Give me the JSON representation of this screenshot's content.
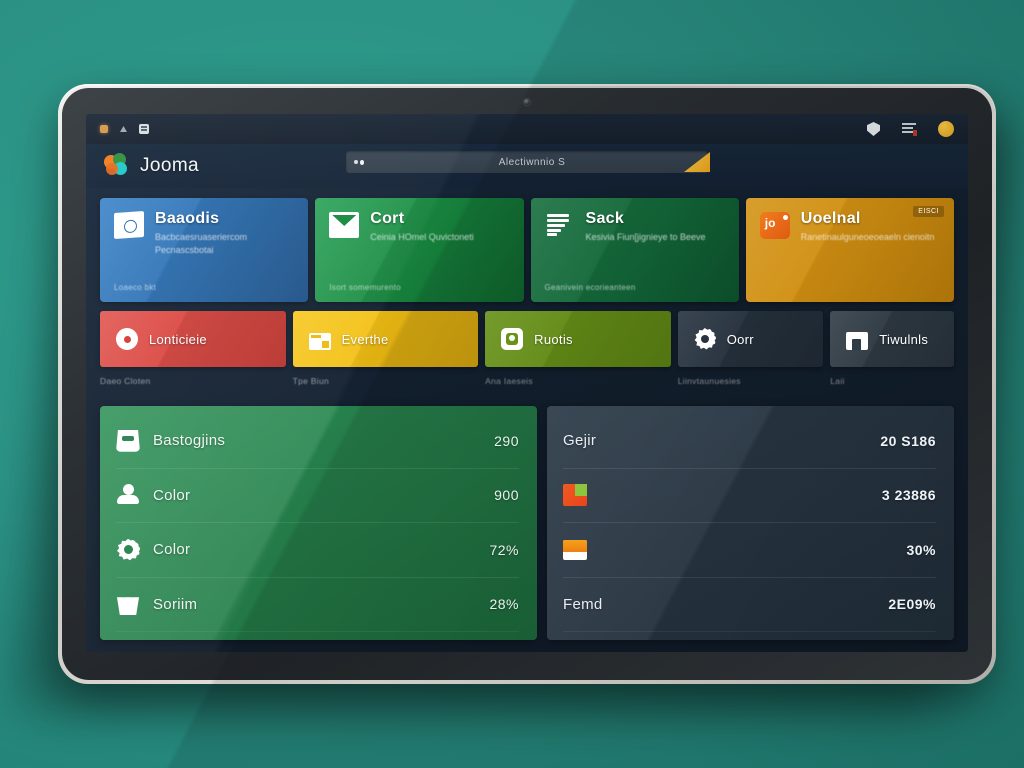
{
  "background": {
    "color": "#2b9285"
  },
  "browser_chrome": {
    "tab_icons": [
      "window-icon",
      "triangle-icon",
      "browser-icon"
    ],
    "right_icons": [
      "shield-icon",
      "menu-lines-icon",
      "avatar-icon"
    ]
  },
  "app_header": {
    "brand": "Jooma",
    "omnibox": {
      "value": "Alectiwnnio S",
      "lock_icon": "lock-icon",
      "flag_icon": "flag-icon"
    }
  },
  "big_cards": [
    {
      "title": "Baaodis",
      "subtitle": "Bacbcaesruaseriercom Pecnascsbotai",
      "footer": "Loaeco bkt",
      "icon": "money-icon",
      "accent": "#2a6db0",
      "badge": ""
    },
    {
      "title": "Cort",
      "subtitle": "Ceinia HOmel Quvictoneti",
      "footer": "Isort somemurento",
      "icon": "mail-icon",
      "accent": "#17883f",
      "badge": ""
    },
    {
      "title": "Sack",
      "subtitle": "Kesivia Fiun[jignieye to Beeve",
      "footer": "Geanivein ecorieanteen",
      "icon": "document-icon",
      "accent": "#15733f",
      "badge": ""
    },
    {
      "title": "Uoelnal",
      "subtitle": "Ranetinaulguneoeoeaeln cienoitn",
      "footer": "",
      "icon": "joomla-icon",
      "accent": "#e99f12",
      "badge": "EISCI"
    }
  ],
  "small_tiles": [
    {
      "label": "Lonticieie",
      "caption": "Daeo Cloten",
      "icon": "ring-icon",
      "accent": "#d23c36"
    },
    {
      "label": "Everthe",
      "caption": "Tpe Biun",
      "icon": "card-icon",
      "accent": "#efb910"
    },
    {
      "label": "Ruotis",
      "caption": "Ana Iaeseis",
      "icon": "rounded-square-icon",
      "accent": "#689415"
    },
    {
      "label": "Oorr",
      "caption": "Liinvtaunuesies",
      "icon": "gear-icon",
      "accent": "#26323e"
    },
    {
      "label": "Tiwulnls",
      "caption": "Laii",
      "icon": "bag-icon",
      "accent": "#2f3b45"
    }
  ],
  "panel_left": {
    "rows": [
      {
        "label": "Bastogjins",
        "value": "290",
        "icon": "inbox-icon"
      },
      {
        "label": "Color",
        "value": "900",
        "icon": "user-icon"
      },
      {
        "label": "Color",
        "value": "72%",
        "icon": "gear-icon"
      },
      {
        "label": "Soriim",
        "value": "28%",
        "icon": "basket-icon"
      }
    ]
  },
  "panel_right": {
    "rows": [
      {
        "label": "Gejir",
        "value": "20 S186",
        "icon": ""
      },
      {
        "label": "",
        "value": "3 23886",
        "icon": "swatch-green-orange-icon"
      },
      {
        "label": "",
        "value": "30%",
        "icon": "swatch-orange-white-icon"
      },
      {
        "label": "Femd",
        "value": "2E09%",
        "icon": ""
      }
    ]
  }
}
